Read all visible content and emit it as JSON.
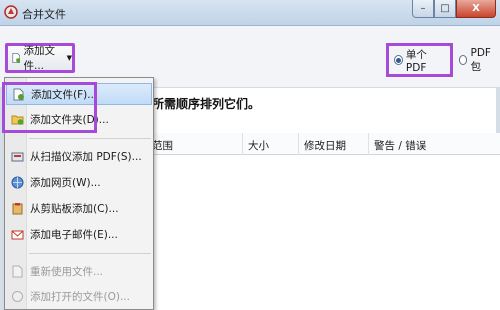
{
  "window": {
    "title": "合并文件",
    "min_symbol": "–",
    "max_symbol": "□",
    "close_symbol": "X"
  },
  "toolbar": {
    "add_files_label": "添加文件...",
    "caret": "▼"
  },
  "output_mode": {
    "single_pdf_label": "单个 PDF",
    "pdf_package_label": "PDF 包",
    "selected": "single_pdf"
  },
  "instruction": "所需顺序排列它们。",
  "table": {
    "columns": [
      "范围",
      "大小",
      "修改日期",
      "警告 / 错误"
    ]
  },
  "menu": {
    "items": [
      {
        "label": "添加文件(F)...",
        "icon": "add-file-icon",
        "state": "highlighted"
      },
      {
        "label": "添加文件夹(D)...",
        "icon": "add-folder-icon",
        "state": "normal"
      },
      {
        "label": "从扫描仪添加 PDF(S)...",
        "icon": "scanner-icon",
        "state": "normal"
      },
      {
        "label": "添加网页(W)...",
        "icon": "web-page-icon",
        "state": "normal"
      },
      {
        "label": "从剪贴板添加(C)...",
        "icon": "clipboard-icon",
        "state": "normal"
      },
      {
        "label": "添加电子邮件(E)...",
        "icon": "email-icon",
        "state": "normal"
      },
      {
        "label": "重新使用文件...",
        "icon": "reuse-file-icon",
        "state": "disabled"
      },
      {
        "label": "添加打开的文件(O)...",
        "icon": "open-files-icon",
        "state": "disabled"
      }
    ]
  },
  "colors": {
    "highlight_outline": "#a64bd9",
    "menu_hover": "#c1dbf6",
    "titlebar": "#bfd3e8"
  }
}
